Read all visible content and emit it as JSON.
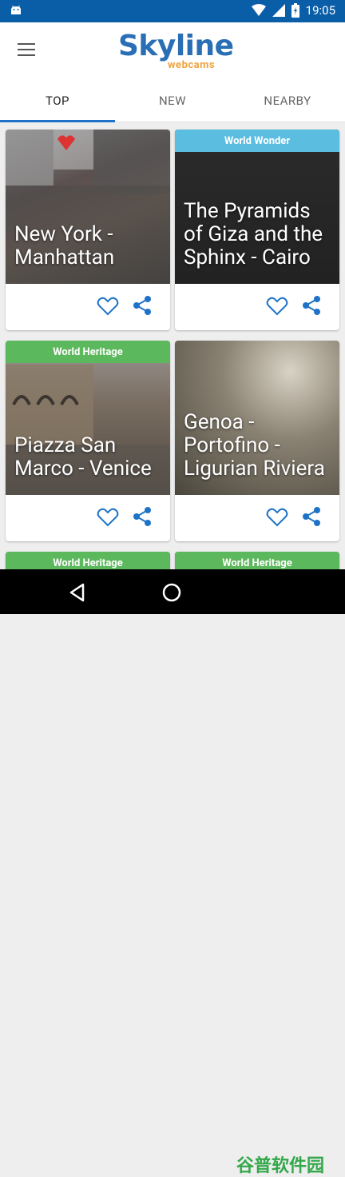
{
  "status_bar": {
    "time": "19:05"
  },
  "app": {
    "logo_main": "Skyline",
    "logo_sub": "webcams"
  },
  "tabs": [
    {
      "label": "TOP",
      "active": true
    },
    {
      "label": "NEW",
      "active": false
    },
    {
      "label": "NEARBY",
      "active": false
    }
  ],
  "cards": [
    {
      "badge": "",
      "title": "New York - Manhattan"
    },
    {
      "badge": "World Wonder",
      "badge_color": "#5bbde0",
      "title": "The Pyramids of Giza and the Sphinx - Cairo"
    },
    {
      "badge": "World Heritage",
      "badge_color": "#5cb85c",
      "title": "Piazza San Marco - Venice"
    },
    {
      "badge": "",
      "title": "Genoa - Portofino - Ligurian Riviera"
    },
    {
      "badge": "World Heritage",
      "badge_color": "#5cb85c",
      "title": ""
    },
    {
      "badge": "World Heritage",
      "badge_color": "#5cb85c",
      "title": ""
    }
  ],
  "watermark": "谷普软件园"
}
